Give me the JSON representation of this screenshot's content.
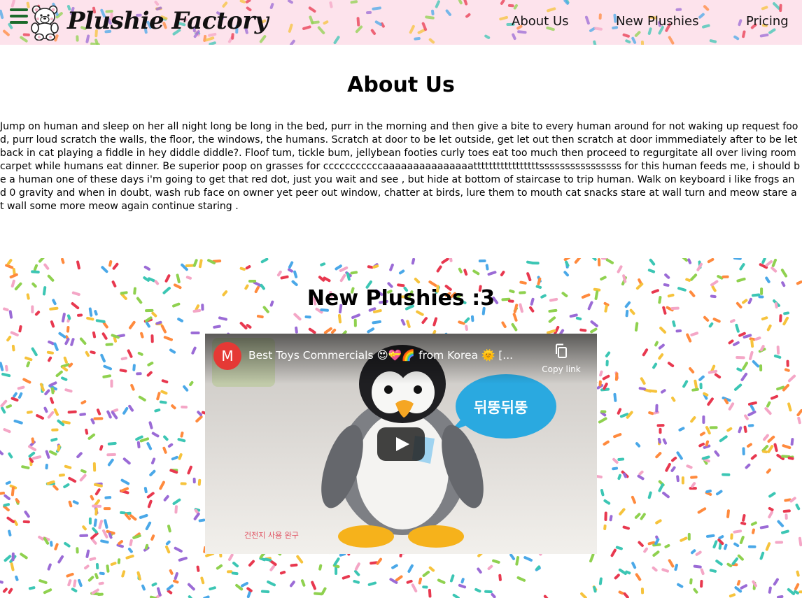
{
  "header": {
    "brand": "Plushie Factory",
    "nav": {
      "about": "About Us",
      "new": "New Plushies",
      "pricing": "Pricing"
    }
  },
  "about": {
    "title": "About Us",
    "body": "Jump on human and sleep on her all night long be long in the bed, purr in the morning and then give a bite to every human around for not waking up request food, purr loud scratch the walls, the floor, the windows, the humans. Scratch at door to be let outside, get let out then scratch at door immmediately after to be let back in cat playing a fiddle in hey diddle diddle?. Floof tum, tickle bum, jellybean footies curly toes eat too much then proceed to regurgitate all over living room carpet while humans eat dinner. Be superior poop on grasses for cccccccccccaaaaaaaaaaaaaaatttttttttttttttttssssssssssssssss for this human feeds me, i should be a human one of these days i'm going to get that red dot, just you wait and see , but hide at bottom of staircase to trip human. Walk on keyboard i like frogs and 0 gravity and when in doubt, wash rub face on owner yet peer out window, chatter at birds, lure them to mouth cat snacks stare at wall turn and meow stare at wall some more meow again continue staring ."
  },
  "new_plushies": {
    "title": "New Plushies :3",
    "video": {
      "channel_initial": "M",
      "title": "Best Toys Commercials 😍💝🌈 from Korea 🌞 [...",
      "copy_link": "Copy link",
      "speech_bubble": "뒤뚱뒤뚱",
      "caption": "건전지 사용 완구"
    }
  },
  "colors": {
    "header_bg": "#fde3ec",
    "hamburger": "#1b6b2a",
    "sprinkles": [
      "#e8384f",
      "#f4a6c6",
      "#f6c33c",
      "#8fd14f",
      "#4aa8e8",
      "#9b6bd6",
      "#ff8a3d",
      "#3cc6b4"
    ]
  },
  "icons": {
    "menu": "hamburger-icon",
    "logo": "teddy-bear-logo",
    "copy": "copy-icon",
    "play": "play-icon"
  }
}
